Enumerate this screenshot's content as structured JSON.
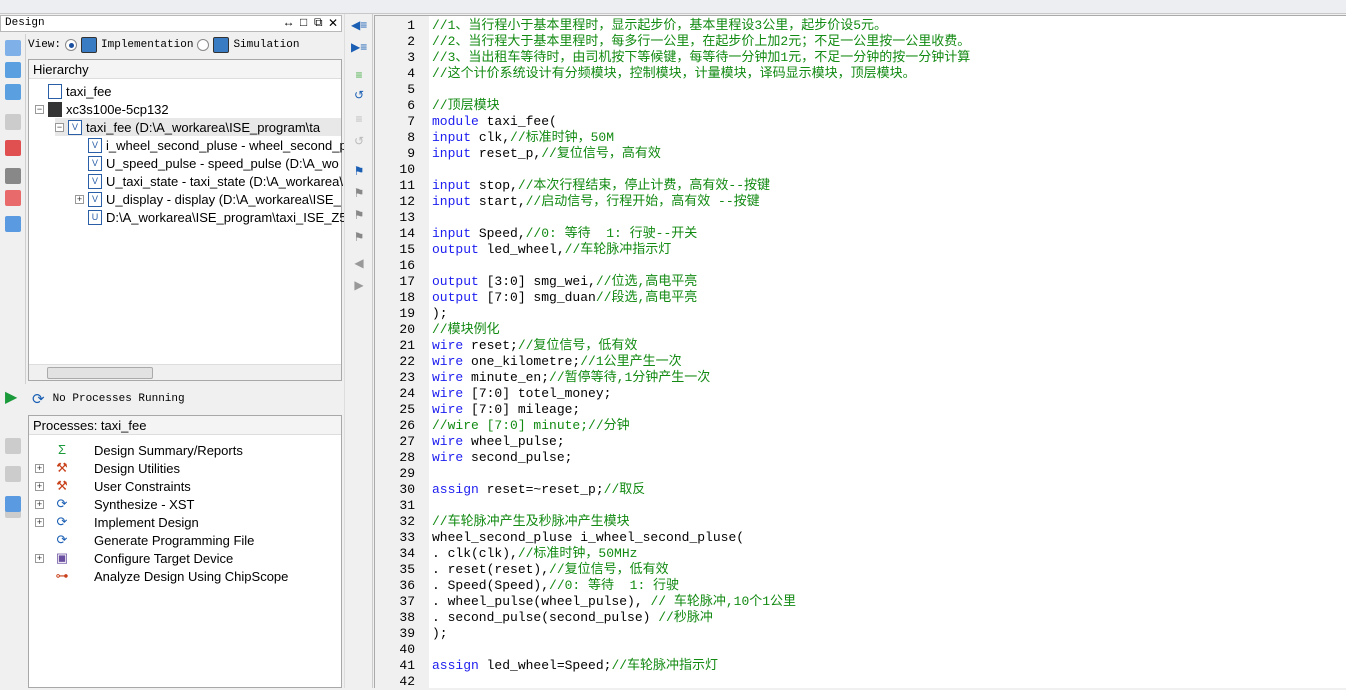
{
  "design_panel": {
    "title": "Design",
    "controls": [
      "↔",
      "□",
      "⧉",
      "✕"
    ],
    "view_label": "View:",
    "view_options": [
      {
        "label": "Implementation",
        "selected": true
      },
      {
        "label": "Simulation",
        "selected": false
      }
    ]
  },
  "hierarchy": {
    "title": "Hierarchy",
    "items": [
      {
        "label": "taxi_fee",
        "indent": 0,
        "icon": "project-icon",
        "expander": ""
      },
      {
        "label": "xc3s100e-5cp132",
        "indent": 0,
        "icon": "chip-icon",
        "expander": "−"
      },
      {
        "label": "taxi_fee (D:\\A_workarea\\ISE_program\\ta",
        "indent": 1,
        "icon": "verilog-top-icon",
        "expander": "−"
      },
      {
        "label": "i_wheel_second_pluse - wheel_second_p",
        "indent": 2,
        "icon": "verilog-file-icon",
        "expander": ""
      },
      {
        "label": "U_speed_pulse - speed_pulse (D:\\A_wo",
        "indent": 2,
        "icon": "verilog-file-icon",
        "expander": ""
      },
      {
        "label": "U_taxi_state - taxi_state (D:\\A_workarea\\",
        "indent": 2,
        "icon": "verilog-file-icon",
        "expander": ""
      },
      {
        "label": "U_display - display (D:\\A_workarea\\ISE_",
        "indent": 2,
        "icon": "verilog-file-icon",
        "expander": "+"
      },
      {
        "label": "D:\\A_workarea\\ISE_program\\taxi_ISE_Z5",
        "indent": 2,
        "icon": "ucf-file-icon",
        "expander": ""
      }
    ]
  },
  "process_status": "No Processes Running",
  "processes": {
    "title": "Processes: taxi_fee",
    "items": [
      {
        "label": "Design Summary/Reports",
        "icon": "sigma-icon",
        "glyph": "Σ",
        "color": "#1a9a3a",
        "expander": ""
      },
      {
        "label": "Design Utilities",
        "icon": "tools-icon",
        "glyph": "⚒",
        "color": "#c8401a",
        "expander": "+"
      },
      {
        "label": "User Constraints",
        "icon": "tools-icon",
        "glyph": "⚒",
        "color": "#c8401a",
        "expander": "+"
      },
      {
        "label": "Synthesize - XST",
        "icon": "refresh-icon",
        "glyph": "⟳",
        "color": "#1a5fb4",
        "expander": "+"
      },
      {
        "label": "Implement Design",
        "icon": "refresh-icon",
        "glyph": "⟳",
        "color": "#1a5fb4",
        "expander": "+"
      },
      {
        "label": "Generate Programming File",
        "icon": "refresh-icon",
        "glyph": "⟳",
        "color": "#1a5fb4",
        "expander": ""
      },
      {
        "label": "Configure Target Device",
        "icon": "device-icon",
        "glyph": "▣",
        "color": "#6a4fa0",
        "expander": "+"
      },
      {
        "label": "Analyze Design Using ChipScope",
        "icon": "chipscope-icon",
        "glyph": "⊶",
        "color": "#c8401a",
        "expander": ""
      }
    ]
  },
  "code": [
    [
      [
        "cm",
        "//1、当行程小于基本里程时，显示起步价，基本里程设3公里，起步价设5元。"
      ]
    ],
    [
      [
        "cm",
        "//2、当行程大于基本里程时，每多行一公里，在起步价上加2元；不足一公里按一公里收费。"
      ]
    ],
    [
      [
        "cm",
        "//3、当出租车等待时，由司机按下等候键，每等待一分钟加1元，不足一分钟的按一分钟计算"
      ]
    ],
    [
      [
        "cm",
        "//这个计价系统设计有分频模块，控制模块，计量模块，译码显示模块，顶层模块。"
      ]
    ],
    [],
    [
      [
        "cm",
        "//顶层模块"
      ]
    ],
    [
      [
        "kw",
        "module"
      ],
      [
        "tx",
        " taxi_fee("
      ]
    ],
    [
      [
        "kw",
        "input"
      ],
      [
        "tx",
        " clk,"
      ],
      [
        "cm",
        "//标准时钟，50M"
      ]
    ],
    [
      [
        "kw",
        "input"
      ],
      [
        "tx",
        " reset_p,"
      ],
      [
        "cm",
        "//复位信号，高有效"
      ]
    ],
    [],
    [
      [
        "kw",
        "input"
      ],
      [
        "tx",
        " stop,"
      ],
      [
        "cm",
        "//本次行程结束，停止计费，高有效--按键"
      ]
    ],
    [
      [
        "kw",
        "input"
      ],
      [
        "tx",
        " start,"
      ],
      [
        "cm",
        "//启动信号，行程开始，高有效 --按键"
      ]
    ],
    [],
    [
      [
        "kw",
        "input"
      ],
      [
        "tx",
        " Speed,"
      ],
      [
        "cm",
        "//0: 等待  1: 行驶--开关"
      ]
    ],
    [
      [
        "kw",
        "output"
      ],
      [
        "tx",
        " led_wheel,"
      ],
      [
        "cm",
        "//车轮脉冲指示灯"
      ]
    ],
    [],
    [
      [
        "kw",
        "output"
      ],
      [
        "tx",
        " [3:0] smg_wei,"
      ],
      [
        "cm",
        "//位选,高电平亮"
      ]
    ],
    [
      [
        "kw",
        "output"
      ],
      [
        "tx",
        " [7:0] smg_duan"
      ],
      [
        "cm",
        "//段选,高电平亮"
      ]
    ],
    [
      [
        "tx",
        ");"
      ]
    ],
    [
      [
        "cm",
        "//模块例化"
      ]
    ],
    [
      [
        "kw",
        "wire"
      ],
      [
        "tx",
        " reset;"
      ],
      [
        "cm",
        "//复位信号，低有效"
      ]
    ],
    [
      [
        "kw",
        "wire"
      ],
      [
        "tx",
        " one_kilometre;"
      ],
      [
        "cm",
        "//1公里产生一次"
      ]
    ],
    [
      [
        "kw",
        "wire"
      ],
      [
        "tx",
        " minute_en;"
      ],
      [
        "cm",
        "//暂停等待,1分钟产生一次"
      ]
    ],
    [
      [
        "kw",
        "wire"
      ],
      [
        "tx",
        " [7:0] totel_money;"
      ]
    ],
    [
      [
        "kw",
        "wire"
      ],
      [
        "tx",
        " [7:0] mileage;"
      ]
    ],
    [
      [
        "cm",
        "//wire [7:0] minute;//分钟"
      ]
    ],
    [
      [
        "kw",
        "wire"
      ],
      [
        "tx",
        " wheel_pulse;"
      ]
    ],
    [
      [
        "kw",
        "wire"
      ],
      [
        "tx",
        " second_pulse;"
      ]
    ],
    [],
    [
      [
        "kw",
        "assign"
      ],
      [
        "tx",
        " reset=~reset_p;"
      ],
      [
        "cm",
        "//取反"
      ]
    ],
    [],
    [
      [
        "cm",
        "//车轮脉冲产生及秒脉冲产生模块"
      ]
    ],
    [
      [
        "tx",
        "wheel_second_pluse i_wheel_second_pluse("
      ]
    ],
    [
      [
        "tx",
        ". clk(clk),"
      ],
      [
        "cm",
        "//标准时钟，50MHz"
      ]
    ],
    [
      [
        "tx",
        ". reset(reset),"
      ],
      [
        "cm",
        "//复位信号，低有效"
      ]
    ],
    [
      [
        "tx",
        ". Speed(Speed),"
      ],
      [
        "cm",
        "//0: 等待  1: 行驶"
      ]
    ],
    [
      [
        "tx",
        ". wheel_pulse(wheel_pulse), "
      ],
      [
        "cm",
        "// 车轮脉冲,10个1公里"
      ]
    ],
    [
      [
        "tx",
        ". second_pulse(second_pulse) "
      ],
      [
        "cm",
        "//秒脉冲"
      ]
    ],
    [
      [
        "tx",
        ");"
      ]
    ],
    [],
    [
      [
        "kw",
        "assign"
      ],
      [
        "tx",
        " led_wheel=Speed;"
      ],
      [
        "cm",
        "//车轮脉冲指示灯"
      ]
    ],
    []
  ]
}
